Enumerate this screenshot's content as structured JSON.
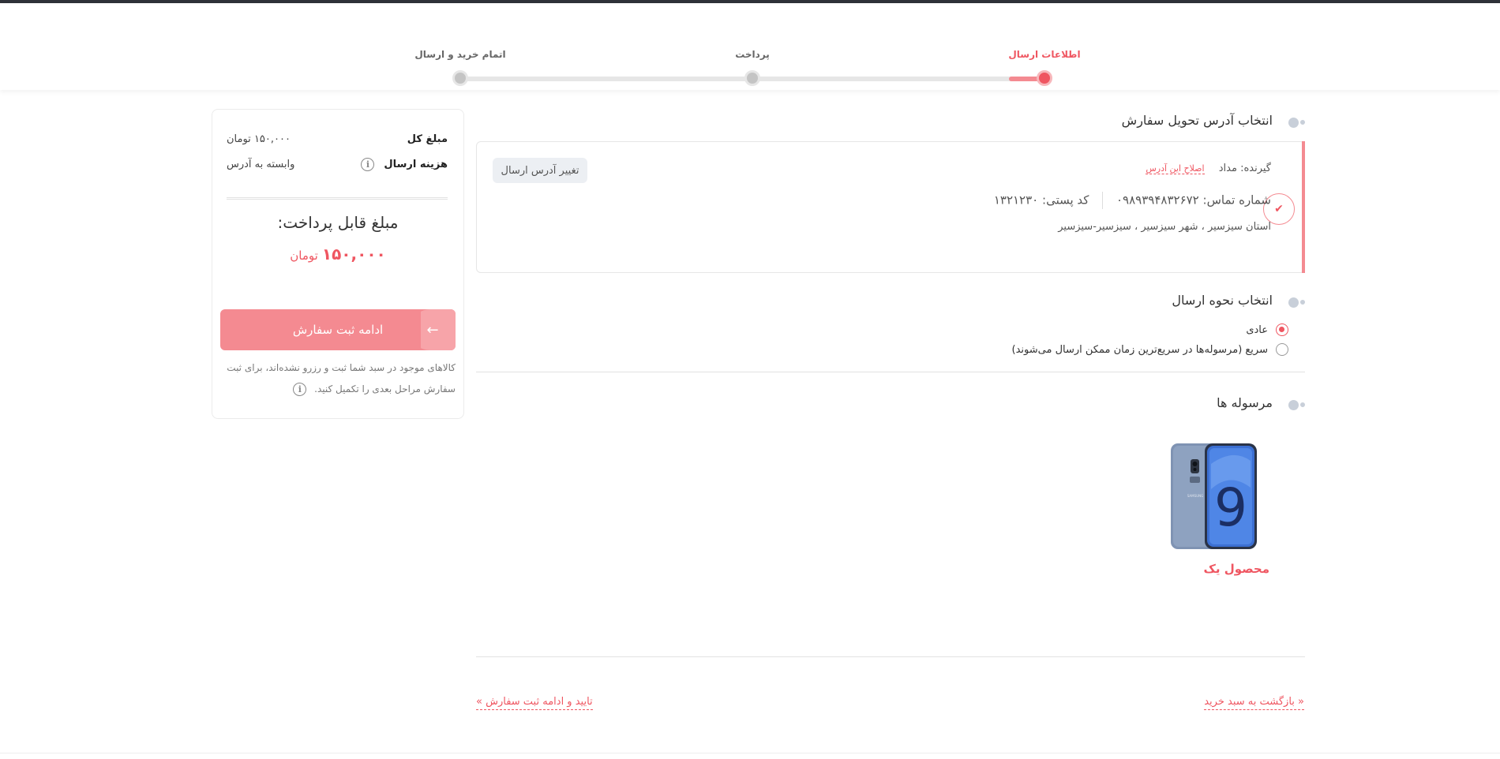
{
  "stepper": {
    "steps": [
      {
        "label": "اطلاعات ارسال",
        "state": "active"
      },
      {
        "label": "پرداخت",
        "state": "pending"
      },
      {
        "label": "اتمام خرید و ارسال",
        "state": "pending"
      }
    ]
  },
  "summary": {
    "total_label": "مبلغ کل",
    "total_value": "۱۵۰,۰۰۰ تومان",
    "shipping_label": "هزینه ارسال",
    "shipping_value": "وابسته به آدرس",
    "payable_label": "مبلغ قابل پرداخت:",
    "payable_amount": "۱۵۰,۰۰۰",
    "payable_currency": "تومان",
    "continue_button": "ادامه ثبت سفارش",
    "note": "کالاهای موجود در سبد شما ثبت و رزرو نشده‌اند، برای ثبت سفارش مراحل بعدی را تکمیل کنید."
  },
  "address_section": {
    "title": "انتخاب آدرس تحویل سفارش",
    "recipient_label": "گیرنده:",
    "recipient_name": "مداد",
    "edit_link": "اصلاح این آدرس",
    "phone_label": "شماره تماس:",
    "phone_value": "۰۹۸۹۳۹۴۸۳۲۶۷۲",
    "postal_label": "کد پستی:",
    "postal_value": "۱۳۲۱۲۳۰",
    "address_text": "استان سیزسیر ، شهر سیزسیر ، سیزسیر-سیزسیر",
    "change_button": "تغییر آدرس ارسال"
  },
  "shipping_section": {
    "title": "انتخاب نحوه ارسال",
    "options": [
      {
        "label": "عادی",
        "selected": true
      },
      {
        "label": "سریع (مرسوله‌ها در سریع‌ترین زمان ممکن ارسال می‌شوند)",
        "selected": false
      }
    ]
  },
  "parcels_section": {
    "title": "مرسوله ها",
    "product_name": "محصول یک",
    "product_image": "samsung-galaxy-s9-phone-image"
  },
  "navigation": {
    "back_link": "« بازگشت به سبد خرید",
    "confirm_link": "تایید و ادامه ثبت سفارش »"
  },
  "colors": {
    "accent": "#ef5661",
    "accent_light": "#f48a91",
    "topbar": "#2f3239"
  }
}
